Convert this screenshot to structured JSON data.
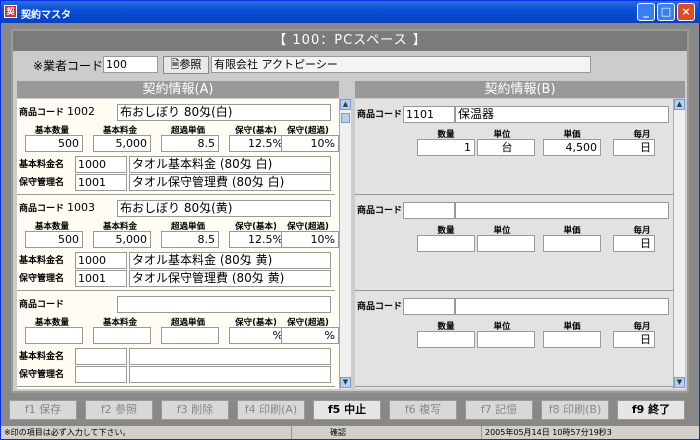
{
  "window": {
    "title": "契約マスタ",
    "icon": "app-icon"
  },
  "header": {
    "title": "【 100：PCスペース 】"
  },
  "vendor": {
    "label": "※業者コード",
    "code": "100",
    "ref_button": "参照",
    "name": "有限会社 アクトピーシー"
  },
  "panelA": {
    "title": "契約情報(A)",
    "col_headers": [
      "基本数量",
      "基本料金",
      "超過単価",
      "保守(基本)",
      "保守(超過)"
    ],
    "code_label": "商品コード",
    "fee_name_label": "基本料金名",
    "maint_name_label": "保守管理名",
    "items": [
      {
        "code": "1002",
        "name": "布おしぼり 80匁(白)",
        "qty": "500",
        "fee": "5,000",
        "over": "8.5",
        "mb": "12.5%",
        "mo": "10%",
        "fee_code": "1000",
        "fee_name": "タオル基本料金 (80匁 白)",
        "maint_code": "1001",
        "maint_name": "タオル保守管理費 (80匁 白)"
      },
      {
        "code": "1003",
        "name": "布おしぼり 80匁(黄)",
        "qty": "500",
        "fee": "5,000",
        "over": "8.5",
        "mb": "12.5%",
        "mo": "10%",
        "fee_code": "1000",
        "fee_name": "タオル基本料金 (80匁 黄)",
        "maint_code": "1001",
        "maint_name": "タオル保守管理費 (80匁 黄)"
      },
      {
        "code": "",
        "name": "",
        "qty": "",
        "fee": "",
        "over": "",
        "mb": "%",
        "mo": "%",
        "fee_code": "",
        "fee_name": "",
        "maint_code": "",
        "maint_name": ""
      }
    ]
  },
  "panelB": {
    "title": "契約情報(B)",
    "col_headers": [
      "数量",
      "単位",
      "単価",
      "毎月"
    ],
    "code_label": "商品コード",
    "items": [
      {
        "code": "1101",
        "name": "保温器",
        "qty": "1",
        "unit": "台",
        "price": "4,500",
        "cycle": "日"
      },
      {
        "code": "",
        "name": "",
        "qty": "",
        "unit": "",
        "price": "",
        "cycle": "日"
      },
      {
        "code": "",
        "name": "",
        "qty": "",
        "unit": "",
        "price": "",
        "cycle": "日"
      }
    ]
  },
  "fkeys": [
    "f1 保存",
    "f2 参照",
    "f3 削除",
    "f4 印刷(A)",
    "f5 中止",
    "f6 複写",
    "f7 記憶",
    "f8 印刷(B)",
    "f9 終了"
  ],
  "status": {
    "hint": "※印の項目は必ず入力して下さい。",
    "mode": "確認",
    "datetime": "2005年05月14日 10時57分19秒3"
  }
}
